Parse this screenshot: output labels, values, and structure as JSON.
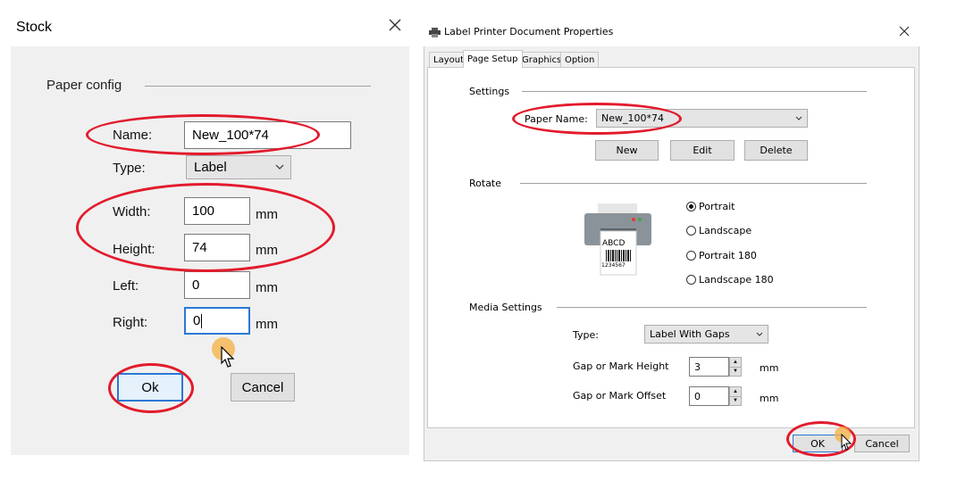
{
  "stock_dialog": {
    "title": "Stock",
    "close_glyph": "✕",
    "group_label": "Paper config",
    "name_label": "Name:",
    "name_value": "New_100*74",
    "type_label": "Type:",
    "type_value": "Label",
    "width_label": "Width:",
    "width_value": "100",
    "height_label": "Height:",
    "height_value": "74",
    "left_label": "Left:",
    "left_value": "0",
    "right_label": "Right:",
    "right_value": "0",
    "unit": "mm",
    "ok_label": "Ok",
    "cancel_label": "Cancel"
  },
  "props_dialog": {
    "title": "Label Printer Document Properties",
    "close_glyph": "✕",
    "tabs": [
      "Layout",
      "Page Setup",
      "Graphics",
      "Option"
    ],
    "active_tab": "Page Setup",
    "settings_label": "Settings",
    "paper_name_label": "Paper Name:",
    "paper_name_value": "New_100*74",
    "new_label": "New",
    "edit_label": "Edit",
    "delete_label": "Delete",
    "rotate_label": "Rotate",
    "printer_label_text": "ABCD",
    "printer_barcode_digits": "1234567",
    "orientations": [
      "Portrait",
      "Landscape",
      "Portrait 180",
      "Landscape 180"
    ],
    "selected_orientation": "Portrait",
    "media_label": "Media Settings",
    "type_label": "Type:",
    "type_value": "Label With Gaps",
    "gap_height_label": "Gap or Mark Height",
    "gap_height_value": "3",
    "gap_offset_label": "Gap or Mark Offset",
    "gap_offset_value": "0",
    "unit": "mm",
    "ok_label": "OK",
    "cancel_label": "Cancel"
  },
  "colors": {
    "highlight_ellipse": "#e21b2c",
    "focus_border": "#2b78d4",
    "cursor_dot": "#f5b041"
  }
}
